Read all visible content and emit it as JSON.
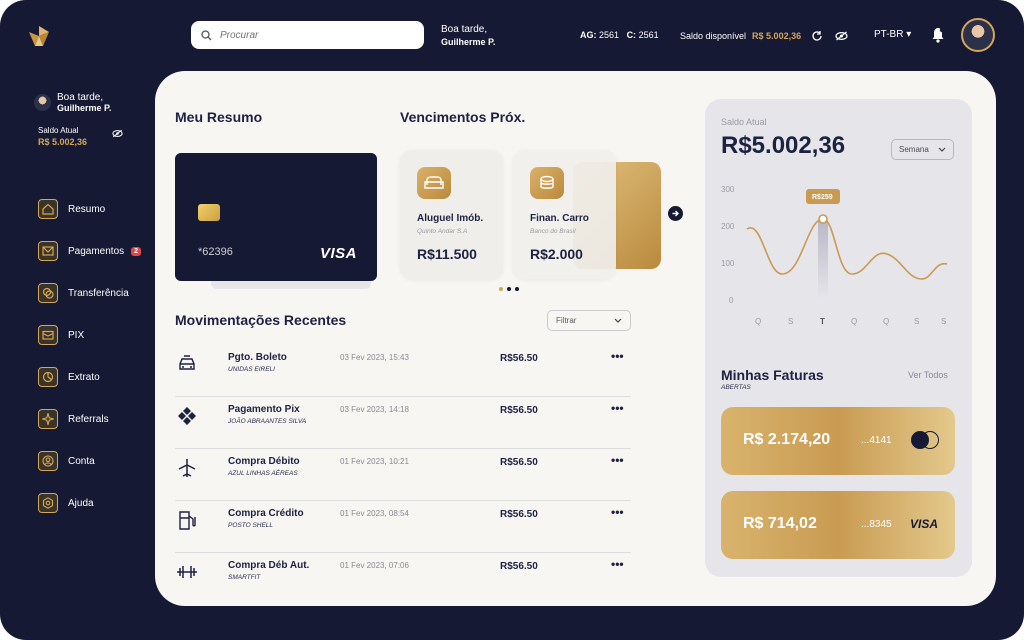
{
  "topbar": {
    "search_placeholder": "Procurar",
    "greeting": "Boa tarde,",
    "user_name": "Guilherme P.",
    "agency_label": "AG:",
    "agency_value": "2561",
    "account_label": "C:",
    "account_value": "2561",
    "balance_label": "Saldo disponível",
    "balance_value": "R$ 5.002,36",
    "language": "PT-BR ▾"
  },
  "sidebar": {
    "greeting": "Boa tarde,",
    "user_name": "Guilherme P.",
    "balance_label": "Saldo Atual",
    "balance_value": "R$ 5.002,36",
    "items": [
      {
        "label": "Resumo",
        "icon": "home-icon"
      },
      {
        "label": "Pagamentos",
        "icon": "envelope-icon",
        "badge": "2"
      },
      {
        "label": "Transferência",
        "icon": "chat-icon"
      },
      {
        "label": "PIX",
        "icon": "wallet-icon"
      },
      {
        "label": "Extrato",
        "icon": "pie-chart-icon"
      },
      {
        "label": "Referrals",
        "icon": "sparkle-icon"
      },
      {
        "label": "Conta",
        "icon": "user-icon"
      },
      {
        "label": "Ajuda",
        "icon": "help-icon"
      }
    ]
  },
  "summary": {
    "title": "Meu Resumo",
    "card_number": "*62396",
    "card_brand": "VISA"
  },
  "due": {
    "title": "Vencimentos Próx.",
    "bills": [
      {
        "title": "Aluguel Imób.",
        "sub": "Quinto Andar S.A",
        "value": "R$11.500",
        "icon": "sofa-icon"
      },
      {
        "title": "Finan. Carro",
        "sub": "Banco do Brasil",
        "value": "R$2.000",
        "icon": "coins-icon"
      }
    ]
  },
  "transactions": {
    "title": "Movimentações Recentes",
    "filter_label": "Filtrar",
    "more": "•••",
    "items": [
      {
        "name": "Pgto. Boleto",
        "sub": "UNIDAS  EIRELI",
        "date": "03 Fev 2023, 15:43",
        "amount": "R$56.50",
        "icon": "car-icon"
      },
      {
        "name": "Pagamento Pix",
        "sub": "JOÃO ABRAANTES SILVA",
        "date": "03 Fev 2023, 14:18",
        "amount": "R$56.50",
        "icon": "pix-icon"
      },
      {
        "name": "Compra Débito",
        "sub": "AZUL LINHAS AÉREAS",
        "date": "01 Fev 2023, 10:21",
        "amount": "R$56.50",
        "icon": "plane-icon"
      },
      {
        "name": "Compra Crédito",
        "sub": "POSTO SHELL",
        "date": "01 Fev 2023, 08:54",
        "amount": "R$56.50",
        "icon": "fuel-icon"
      },
      {
        "name": "Compra Déb Aut.",
        "sub": "SMARTFIT",
        "date": "01 Fev 2023, 07:06",
        "amount": "R$56.50",
        "icon": "dumbbell-icon"
      }
    ]
  },
  "balance_panel": {
    "label": "Saldo Atual",
    "value": "R$5.002,36",
    "period": "Semana",
    "chart": {
      "y_ticks": [
        "300",
        "200",
        "100",
        "0"
      ],
      "x_ticks": [
        "Q",
        "S",
        "T",
        "Q",
        "Q",
        "S",
        "S"
      ],
      "tooltip": "R$259"
    }
  },
  "invoices": {
    "title": "Minhas Faturas",
    "subtitle": "ABERTAS",
    "see_all": "Ver Todos",
    "cards": [
      {
        "amount": "R$ 2.174,20",
        "last4": "...4141",
        "brand": "mastercard"
      },
      {
        "amount": "R$ 714,02",
        "last4": "...8345",
        "brand": "VISA"
      }
    ]
  },
  "colors": {
    "navy": "#161933",
    "gold": "#d4a65a",
    "panel": "#f7f6f3"
  }
}
